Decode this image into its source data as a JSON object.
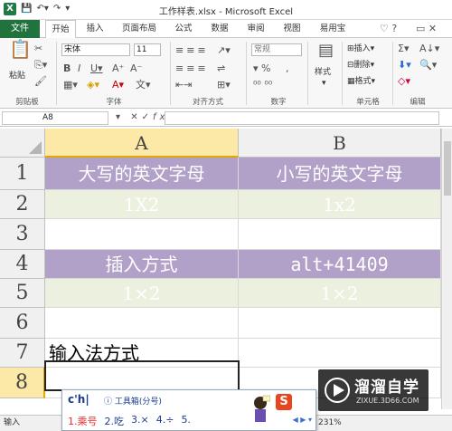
{
  "window": {
    "title": "工作样表.xlsx - Microsoft Excel",
    "app_icon": "X"
  },
  "tabs": [
    {
      "label": "文件"
    },
    {
      "label": "开始"
    },
    {
      "label": "插入"
    },
    {
      "label": "页面布局"
    },
    {
      "label": "公式"
    },
    {
      "label": "数据"
    },
    {
      "label": "审阅"
    },
    {
      "label": "视图"
    },
    {
      "label": "易用宝"
    }
  ],
  "ribbon": {
    "clipboard": {
      "label": "剪贴板",
      "paste": "粘贴"
    },
    "font": {
      "label": "字体",
      "font_name": "宋体",
      "font_size": "11"
    },
    "alignment": {
      "label": "对齐方式"
    },
    "number": {
      "label": "数字",
      "format": "常规"
    },
    "styles": {
      "label": "样式",
      "button": "样式"
    },
    "cells": {
      "label": "单元格",
      "insert": "插入",
      "delete": "删除",
      "format": "格式"
    },
    "editing": {
      "label": "编辑"
    }
  },
  "formula_bar": {
    "name_box": "A8",
    "fx": "fx",
    "value": ""
  },
  "columns": [
    {
      "label": "A"
    },
    {
      "label": "B"
    }
  ],
  "rows": [
    {
      "num": "1",
      "a": "大写的英文字母",
      "b": "小写的英文字母"
    },
    {
      "num": "2",
      "a": "1X2",
      "b": "1x2"
    },
    {
      "num": "3",
      "a": "",
      "b": ""
    },
    {
      "num": "4",
      "a": "插入方式",
      "b": "alt+41409"
    },
    {
      "num": "5",
      "a": "1×2",
      "b": "1×2"
    },
    {
      "num": "6",
      "a": "",
      "b": ""
    },
    {
      "num": "7",
      "a": "输入法方式",
      "b": ""
    },
    {
      "num": "8",
      "a": "",
      "b": ""
    }
  ],
  "status": {
    "mode": "输入",
    "zoom": "231%"
  },
  "ime": {
    "composition": "c'h|",
    "hint": "ⓘ 工具箱(分号)",
    "candidates": [
      "1.乘号",
      "2.吃",
      "3.×",
      "4.÷",
      "5."
    ],
    "logo": "S"
  },
  "watermark": {
    "title": "溜溜自学",
    "url": "ZIXUE.3D66.COM"
  },
  "colors": {
    "header_purple": "#b1a0c7",
    "light_green": "#ebf1de",
    "excel_green": "#21733e"
  }
}
